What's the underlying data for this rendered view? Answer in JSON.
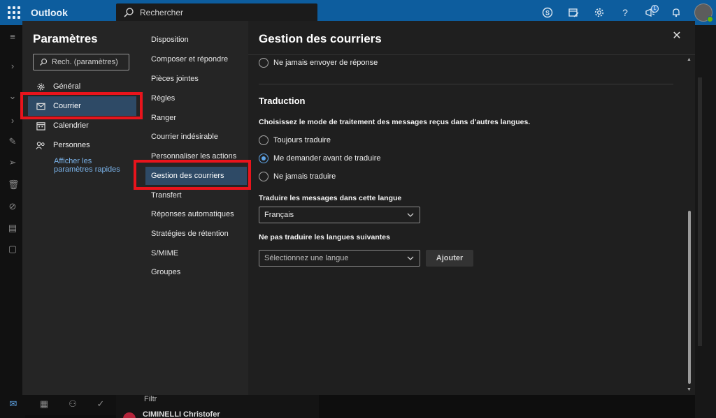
{
  "app": {
    "brand": "Outlook"
  },
  "search": {
    "placeholder": "Rechercher"
  },
  "topbar": {
    "notification_count": "1"
  },
  "background": {
    "filter_label": "Filtr",
    "sender_name": "CIMINELLI Christofer"
  },
  "settings": {
    "title": "Paramètres",
    "search_placeholder": "Rech. (paramètres)",
    "categories": [
      {
        "label": "Général",
        "icon": "gear-icon"
      },
      {
        "label": "Courrier",
        "icon": "mail-icon"
      },
      {
        "label": "Calendrier",
        "icon": "calendar-icon"
      },
      {
        "label": "Personnes",
        "icon": "people-icon"
      }
    ],
    "quick_settings_link": "Afficher les paramètres rapides",
    "mail_sections": [
      "Disposition",
      "Composer et répondre",
      "Pièces jointes",
      "Règles",
      "Ranger",
      "Courrier indésirable",
      "Personnaliser les actions",
      "Gestion des courriers",
      "Transfert",
      "Réponses automatiques",
      "Stratégies de rétention",
      "S/MIME",
      "Groupes"
    ]
  },
  "page": {
    "title": "Gestion des courriers",
    "read_receipt_option": "Ne jamais envoyer de réponse",
    "translation": {
      "title": "Traduction",
      "description": "Choisissez le mode de traitement des messages reçus dans d'autres langues.",
      "options": [
        "Toujours traduire",
        "Me demander avant de traduire",
        "Ne jamais traduire"
      ],
      "selected_option": "Me demander avant de traduire",
      "target_label": "Traduire les messages dans cette langue",
      "target_value": "Français",
      "exclude_label": "Ne pas traduire les langues suivantes",
      "exclude_placeholder": "Sélectionnez une langue",
      "add_button": "Ajouter"
    }
  },
  "colors": {
    "accent": "#0d5d9e",
    "highlight": "#e8141c",
    "selection": "#2e4a66",
    "radio_selected": "#5fa5e8"
  }
}
